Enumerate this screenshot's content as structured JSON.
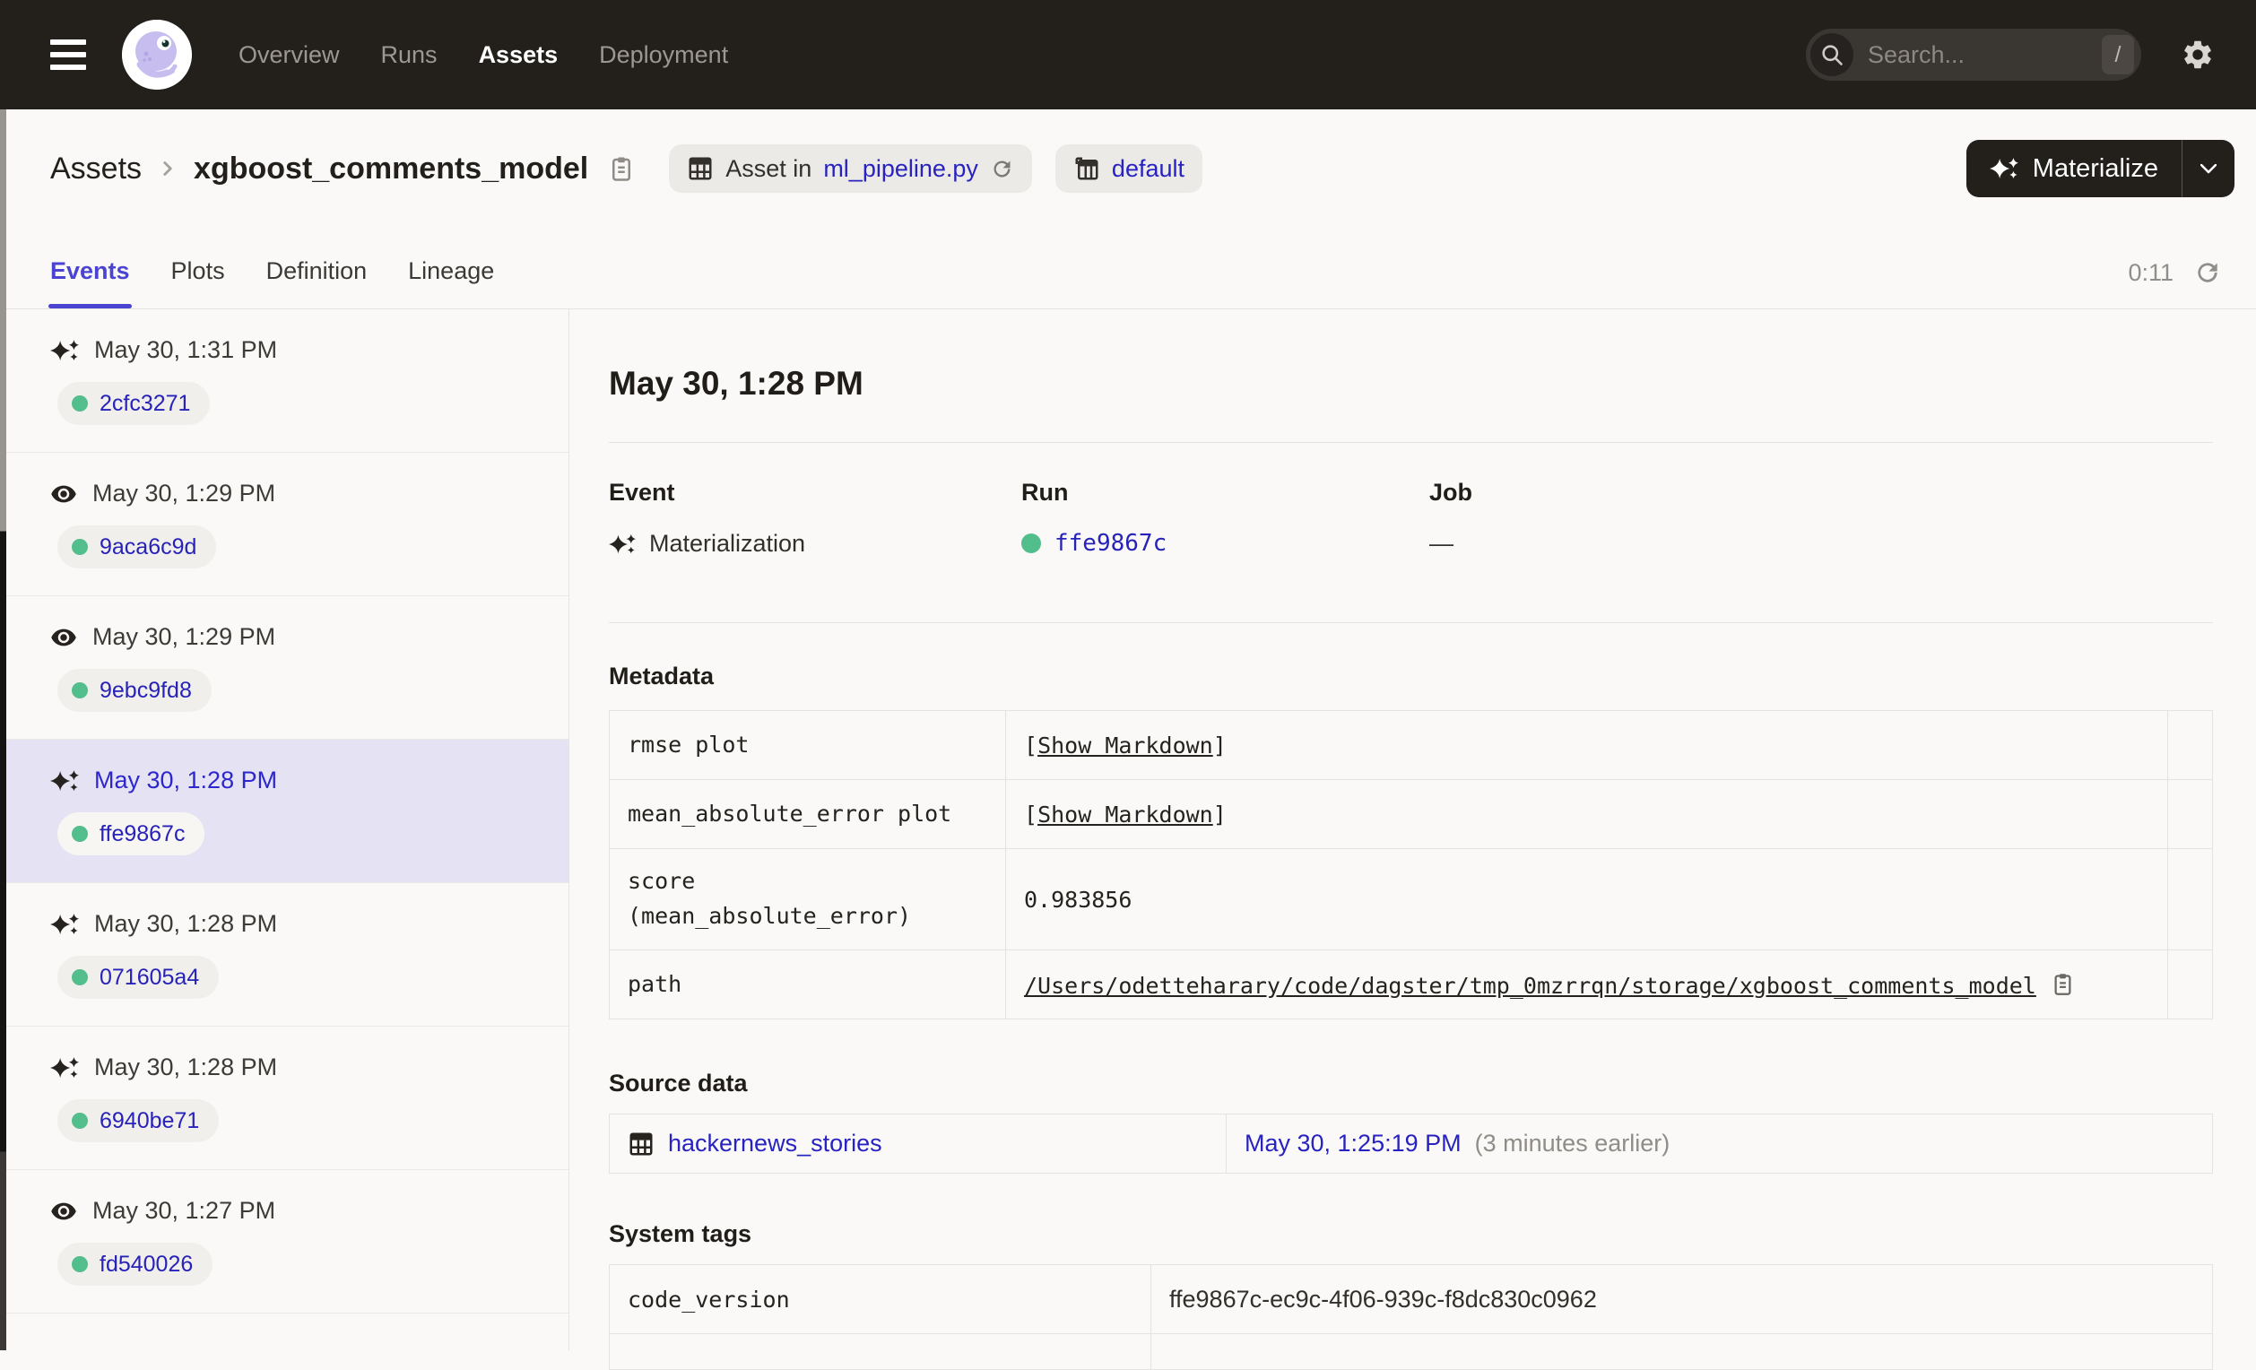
{
  "colors": {
    "header_bg": "#231F1B",
    "accent_tab": "#4B44D2",
    "link_blue": "#2823C0",
    "run_link_blue": "#2722B8",
    "success_green": "#52BE8C",
    "selected_row_bg": "#E4E2F3",
    "page_bg": "#FAF9F7"
  },
  "nav": {
    "items": [
      {
        "label": "Overview"
      },
      {
        "label": "Runs"
      },
      {
        "label": "Assets"
      },
      {
        "label": "Deployment"
      }
    ],
    "active": "Assets",
    "search": {
      "placeholder": "Search...",
      "shortcut": "/"
    }
  },
  "header": {
    "breadcrumb": {
      "root": "Assets",
      "asset_name": "xgboost_comments_model"
    },
    "badges": {
      "asset_in": {
        "prefix": "Asset in",
        "link": "ml_pipeline.py"
      },
      "repo": {
        "label": "default"
      }
    },
    "materialize_label": "Materialize"
  },
  "tabs": {
    "items": [
      {
        "label": "Events"
      },
      {
        "label": "Plots"
      },
      {
        "label": "Definition"
      },
      {
        "label": "Lineage"
      }
    ],
    "active": "Events",
    "refresh_timer": "0:11"
  },
  "sidebar": {
    "events": [
      {
        "icon": "sparkles",
        "time": "May 30, 1:31 PM",
        "run_id": "2cfc3271",
        "selected": false
      },
      {
        "icon": "eye",
        "time": "May 30, 1:29 PM",
        "run_id": "9aca6c9d",
        "selected": false
      },
      {
        "icon": "eye",
        "time": "May 30, 1:29 PM",
        "run_id": "9ebc9fd8",
        "selected": false
      },
      {
        "icon": "sparkles",
        "time": "May 30, 1:28 PM",
        "run_id": "ffe9867c",
        "selected": true
      },
      {
        "icon": "sparkles",
        "time": "May 30, 1:28 PM",
        "run_id": "071605a4",
        "selected": false
      },
      {
        "icon": "sparkles",
        "time": "May 30, 1:28 PM",
        "run_id": "6940be71",
        "selected": false
      },
      {
        "icon": "eye",
        "time": "May 30, 1:27 PM",
        "run_id": "fd540026",
        "selected": false
      }
    ]
  },
  "detail": {
    "title": "May 30, 1:28 PM",
    "summary": {
      "event_label": "Event",
      "event_value": "Materialization",
      "run_label": "Run",
      "run_value": "ffe9867c",
      "job_label": "Job",
      "job_value": "—"
    },
    "metadata": {
      "heading": "Metadata",
      "bracket_open": "[",
      "bracket_close": "]",
      "rows": [
        {
          "key": "rmse plot",
          "type": "markdown",
          "label": "Show Markdown"
        },
        {
          "key": "mean_absolute_error plot",
          "type": "markdown",
          "label": "Show Markdown"
        },
        {
          "key": "score\n(mean_absolute_error)",
          "type": "text",
          "value": "0.983856"
        },
        {
          "key": "path",
          "type": "link",
          "value": "/Users/odetteharary/code/dagster/tmp_0mzrrqn/storage/xgboost_comments_model"
        }
      ]
    },
    "source_data": {
      "heading": "Source data",
      "asset": "hackernews_stories",
      "time": "May 30, 1:25:19 PM",
      "note": "(3 minutes earlier)"
    },
    "system_tags": {
      "heading": "System tags",
      "rows": [
        {
          "key": "code_version",
          "value": "ffe9867c-ec9c-4f06-939c-f8dc830c0962"
        }
      ]
    }
  }
}
